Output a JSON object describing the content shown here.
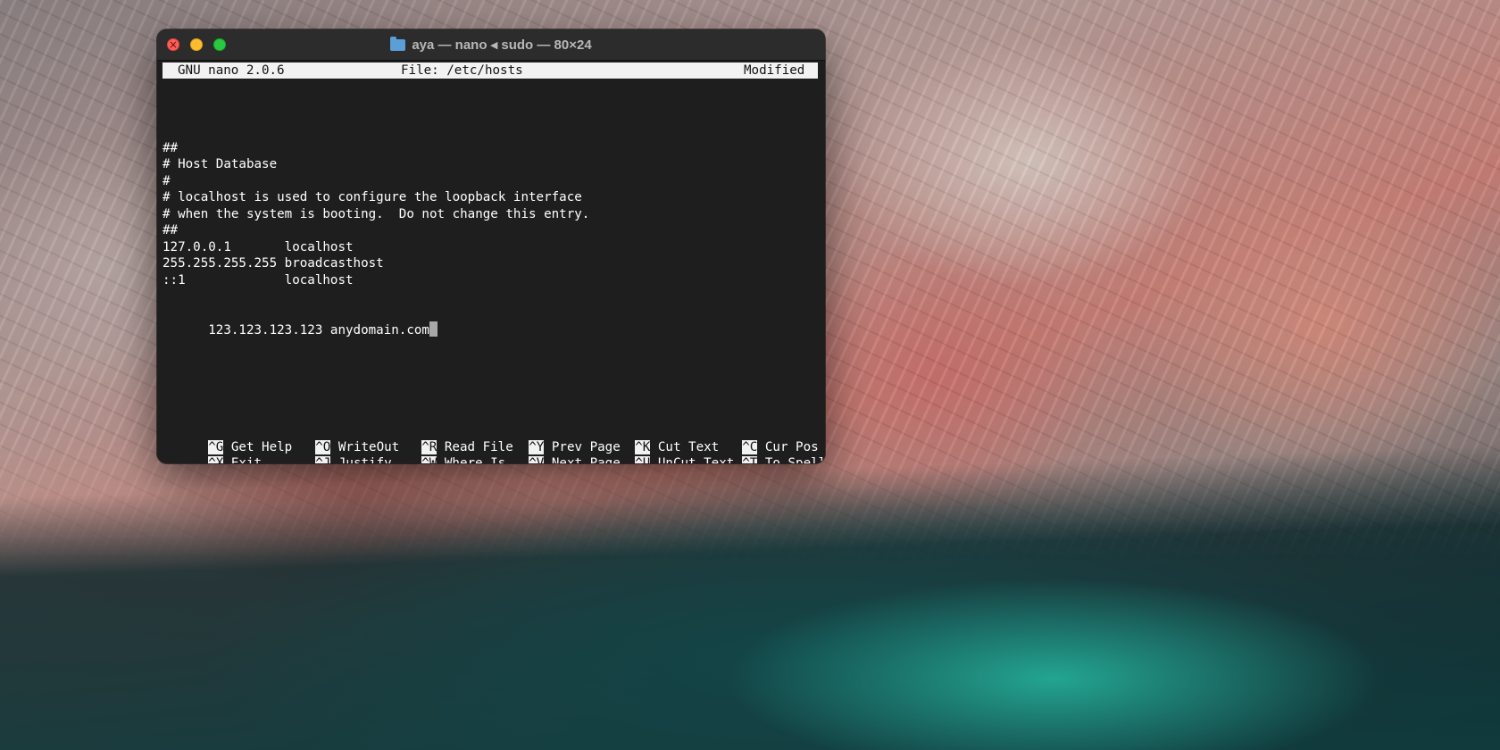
{
  "window": {
    "title": "aya — nano ◂ sudo — 80×24",
    "icons": [
      "close-button",
      "minimize-button",
      "zoom-button",
      "folder-icon"
    ]
  },
  "nano": {
    "header": {
      "version": "GNU nano 2.0.6",
      "file": "File: /etc/hosts",
      "status": "Modified"
    },
    "lines": [
      "",
      "##",
      "# Host Database",
      "#",
      "# localhost is used to configure the loopback interface",
      "# when the system is booting.  Do not change this entry.",
      "##",
      "127.0.0.1       localhost",
      "255.255.255.255 broadcasthost",
      "::1             localhost",
      "",
      "123.123.123.123 anydomain.com"
    ],
    "shortcuts_row1": [
      {
        "key": "^G",
        "label": "Get Help"
      },
      {
        "key": "^O",
        "label": "WriteOut"
      },
      {
        "key": "^R",
        "label": "Read File"
      },
      {
        "key": "^Y",
        "label": "Prev Page"
      },
      {
        "key": "^K",
        "label": "Cut Text"
      },
      {
        "key": "^C",
        "label": "Cur Pos"
      }
    ],
    "shortcuts_row2": [
      {
        "key": "^X",
        "label": "Exit"
      },
      {
        "key": "^J",
        "label": "Justify"
      },
      {
        "key": "^W",
        "label": "Where Is"
      },
      {
        "key": "^V",
        "label": "Next Page"
      },
      {
        "key": "^U",
        "label": "UnCut Text"
      },
      {
        "key": "^T",
        "label": "To Spell"
      }
    ]
  }
}
